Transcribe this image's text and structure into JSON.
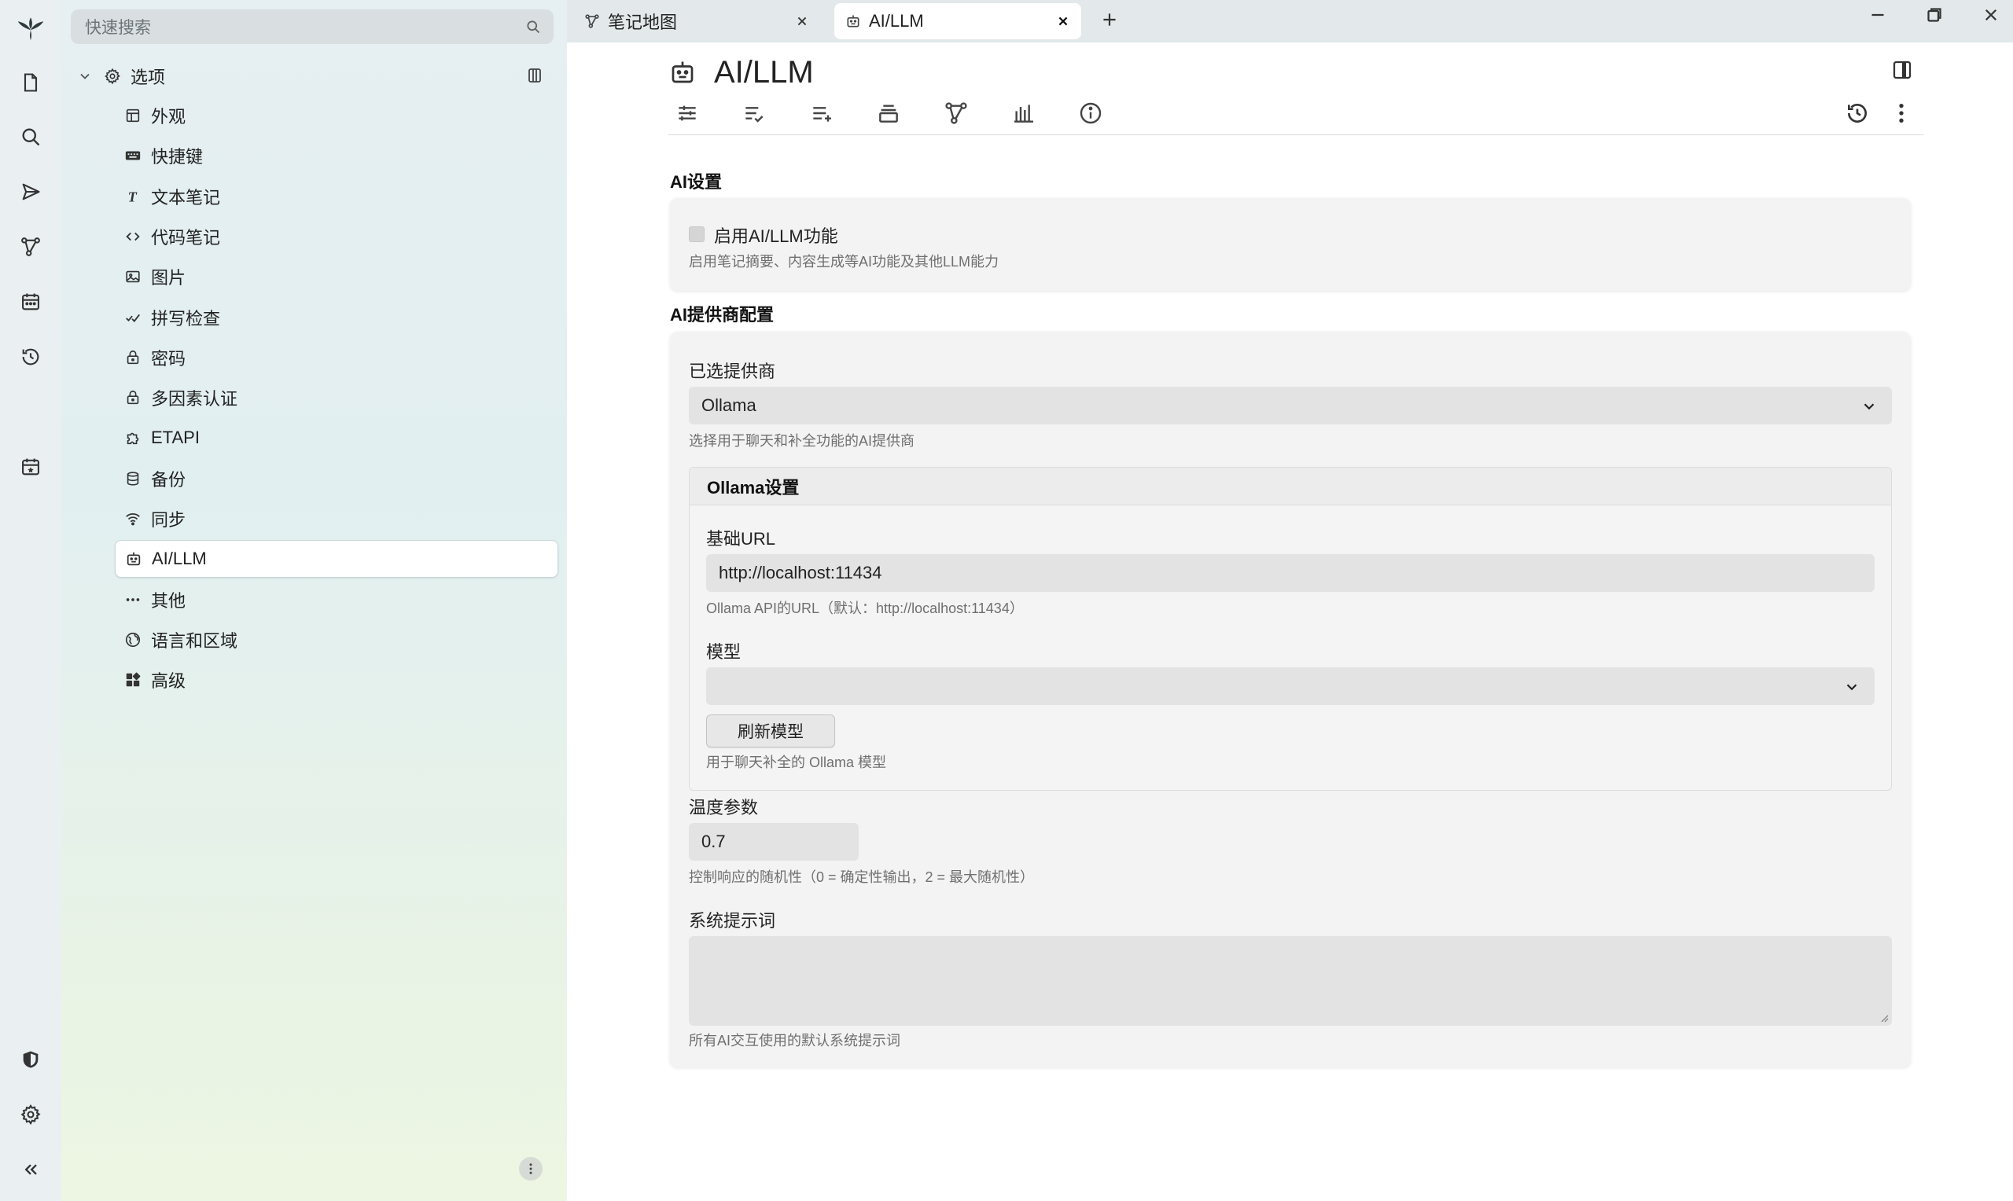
{
  "search": {
    "placeholder": "快速搜索"
  },
  "tree": {
    "root_label": "选项",
    "items": [
      {
        "label": "外观",
        "icon": "layout-icon"
      },
      {
        "label": "快捷键",
        "icon": "keyboard-icon"
      },
      {
        "label": "文本笔记",
        "icon": "text-icon"
      },
      {
        "label": "代码笔记",
        "icon": "code-icon"
      },
      {
        "label": "图片",
        "icon": "image-icon"
      },
      {
        "label": "拼写检查",
        "icon": "spellcheck-icon"
      },
      {
        "label": "密码",
        "icon": "lock-icon"
      },
      {
        "label": "多因素认证",
        "icon": "lock-icon"
      },
      {
        "label": "ETAPI",
        "icon": "puzzle-icon"
      },
      {
        "label": "备份",
        "icon": "database-icon"
      },
      {
        "label": "同步",
        "icon": "wifi-icon"
      },
      {
        "label": "AI/LLM",
        "icon": "robot-icon"
      },
      {
        "label": "其他",
        "icon": "dots-icon"
      },
      {
        "label": "语言和区域",
        "icon": "globe-icon"
      },
      {
        "label": "高级",
        "icon": "grid-icon"
      }
    ],
    "active_item": "AI/LLM"
  },
  "tabs": [
    {
      "label": "笔记地图",
      "icon": "map-icon"
    },
    {
      "label": "AI/LLM",
      "icon": "robot-icon"
    }
  ],
  "note": {
    "title": "AI/LLM"
  },
  "ai_settings": {
    "section_title": "AI设置",
    "enable_label": "启用AI/LLM功能",
    "enable_hint": "启用笔记摘要、内容生成等AI功能及其他LLM能力",
    "enabled": false
  },
  "provider": {
    "section_title": "AI提供商配置",
    "selected_label": "已选提供商",
    "selected_value": "Ollama",
    "selected_hint": "选择用于聊天和补全功能的AI提供商",
    "ollama": {
      "header": "Ollama设置",
      "base_url_label": "基础URL",
      "base_url_value": "http://localhost:11434",
      "base_url_hint": "Ollama API的URL（默认：http://localhost:11434）",
      "model_label": "模型",
      "model_value": "",
      "refresh_label": "刷新模型",
      "model_hint": "用于聊天补全的 Ollama 模型"
    },
    "temperature_label": "温度参数",
    "temperature_value": "0.7",
    "temperature_hint": "控制响应的随机性（0 = 确定性输出，2 = 最大随机性）",
    "system_prompt_label": "系统提示词",
    "system_prompt_value": "",
    "system_prompt_hint": "所有AI交互使用的默认系统提示词"
  }
}
